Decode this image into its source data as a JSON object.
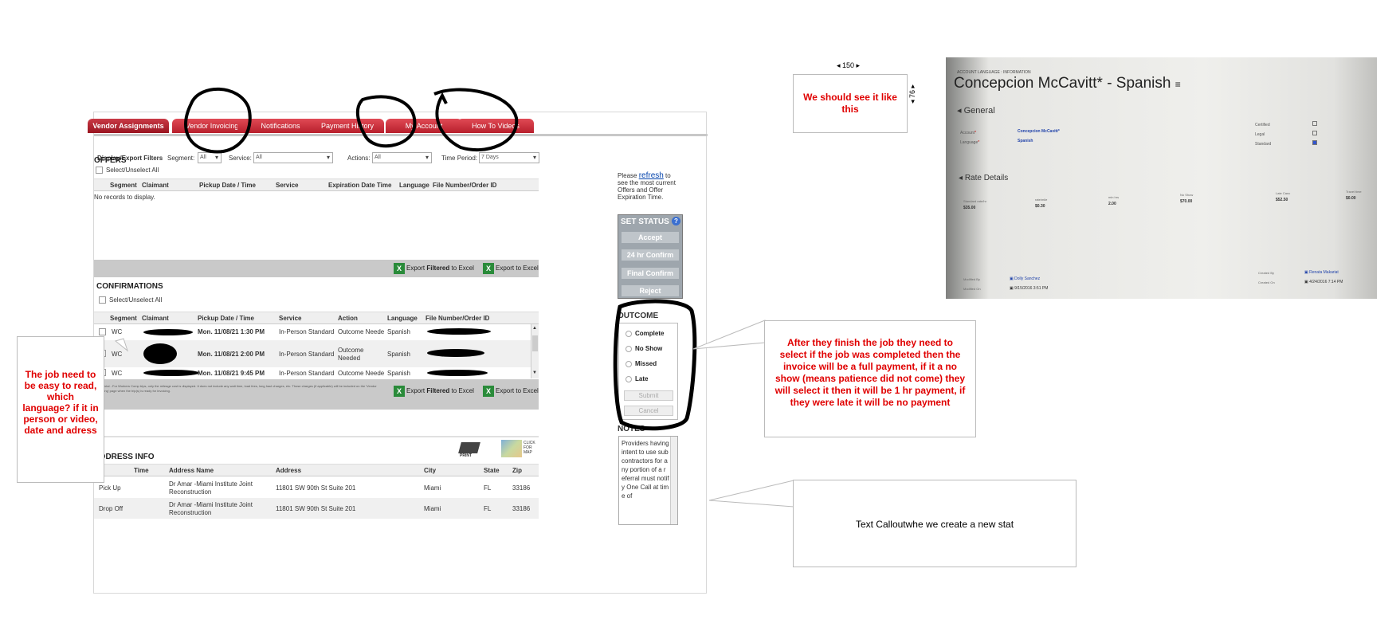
{
  "tabs": [
    "Vendor Assignments",
    "Vendor Invoicing",
    "Notifications",
    "Payment History",
    "My Account",
    "How To Videos"
  ],
  "filters": {
    "title": "Display/Export Filters",
    "segment_label": "Segment:",
    "segment_value": "All",
    "service_label": "Service:",
    "service_value": "All",
    "actions_label": "Actions:",
    "actions_value": "All",
    "period_label": "Time Period:",
    "period_value": "7 Days"
  },
  "offers": {
    "title": "OFFERS",
    "select_all": "Select/Unselect All",
    "columns": [
      "Segment",
      "Claimant",
      "Pickup Date / Time",
      "Service",
      "Expiration Date Time",
      "Language",
      "File Number/Order ID"
    ],
    "empty": "No records to display.",
    "export_filtered_pre": "Export ",
    "export_filtered_bold": "Filtered",
    "export_filtered_post": " to Excel",
    "export_all": "Export to Excel"
  },
  "side": {
    "refresh_pre": "Please ",
    "refresh_link": "refresh",
    "refresh_post": " to see the most current Offers and Offer Expiration Time.",
    "set_status": "SET STATUS",
    "help": "?",
    "buttons": [
      "Accept",
      "24 hr Confirm",
      "Final Confirm",
      "Reject"
    ],
    "outcome_title": "OUTCOME",
    "outcomes": [
      "Complete",
      "No Show",
      "Missed",
      "Late"
    ],
    "submit": "Submit",
    "cancel": "Cancel",
    "notes_title": "NOTES",
    "notes_text": "Providers having intent to use subcontractors for any portion of a referral must notify One Call at time of"
  },
  "confirmations": {
    "title": "CONFIRMATIONS",
    "select_all": "Select/Unselect All",
    "columns": [
      "Segment",
      "Claimant",
      "Pickup Date / Time",
      "Service",
      "Action",
      "Language",
      "File Number/Order ID"
    ],
    "rows": [
      {
        "segment": "WC",
        "date": "Mon. 11/08/21 1:30 PM",
        "service": "In-Person Standard",
        "action": "Outcome Neede",
        "language": "Spanish"
      },
      {
        "segment": "WC",
        "date": "Mon. 11/08/21 2:00 PM",
        "service": "In-Person Standard",
        "action": "Outcome Needed",
        "language": "Spanish"
      },
      {
        "segment": "WC",
        "date": "Mon. 11/08/21 9:45 PM",
        "service": "In-Person Standard",
        "action": "Outcome Neede",
        "language": "Spanish"
      }
    ],
    "footnote": "* Bill Total - For Workers Comp trips, only the mileage cost is displayed. It does not include any wait time, load fees, long haul charges, etc. Those charges (if applicable) will be included on the 'Vendor Invoicing' page when the trip(s) is ready for invoicing.",
    "export_filtered_pre": "Export ",
    "export_filtered_bold": "Filtered",
    "export_filtered_post": " to Excel",
    "export_all": "Export to Excel"
  },
  "address": {
    "title": "ADDRESS INFO",
    "print": "PRINT",
    "map": "CLICK FOR MAP",
    "columns": [
      "Time",
      "Address Name",
      "Address",
      "City",
      "State",
      "Zip"
    ],
    "rows": [
      {
        "type": "Pick Up",
        "name": "Dr Amar -Miami Institute Joint Reconstruction",
        "address": "11801 SW 90th St Suite 201",
        "city": "Miami",
        "state": "FL",
        "zip": "33186"
      },
      {
        "type": "Drop Off",
        "name": "Dr Amar -Miami Institute Joint Reconstruction",
        "address": "11801 SW 90th St Suite 201",
        "city": "Miami",
        "state": "FL",
        "zip": "33186"
      }
    ]
  },
  "callouts": {
    "left": "The job need to be easy to read, which language? if it in person or video, date and adress",
    "top": "We should see it like this",
    "size_w": "◂ 150 ▸",
    "size_h": "◂ 76 ▸",
    "right": "After they finish the job they need to select if the job was completed then the invoice will be a full payment, if it a no show (means patience did not come)  they will select it then it will be 1 hr payment,   if they were late it will be no payment",
    "bottom": "Text Calloutwhe we create a new stat"
  },
  "photo": {
    "crumb": "ACCOUNT LANGUAGE : INFORMATION",
    "title": "Concepcion McCavitt* - Spanish",
    "general": "General",
    "account_label": "Account",
    "account_value": "Concepcion McCavitt*",
    "language_label": "Language",
    "language_value": "Spanish",
    "certified": "Certified",
    "legal": "Legal",
    "standard": "Standard",
    "rate_details": "Rate Details",
    "rates": [
      {
        "label": "Standard rate/hr",
        "value": "$35.00"
      },
      {
        "label": "rate/mile",
        "value": "$0.30"
      },
      {
        "label": "min hrs",
        "value": "2.00"
      },
      {
        "label": "No Show",
        "value": "$70.00"
      },
      {
        "label": "Late Canc",
        "value": "$52.50"
      },
      {
        "label": "Travel time",
        "value": "$0.00"
      }
    ],
    "modified_by_label": "Modified By",
    "modified_by": "Dolly Sanchez",
    "modified_on_label": "Modified On",
    "modified_on": "9/15/2016  3:51 PM",
    "created_by_label": "Created By",
    "created_by": "Renata Makariat",
    "created_on_label": "Created On",
    "created_on": "4/24/2016  7:14 PM"
  }
}
